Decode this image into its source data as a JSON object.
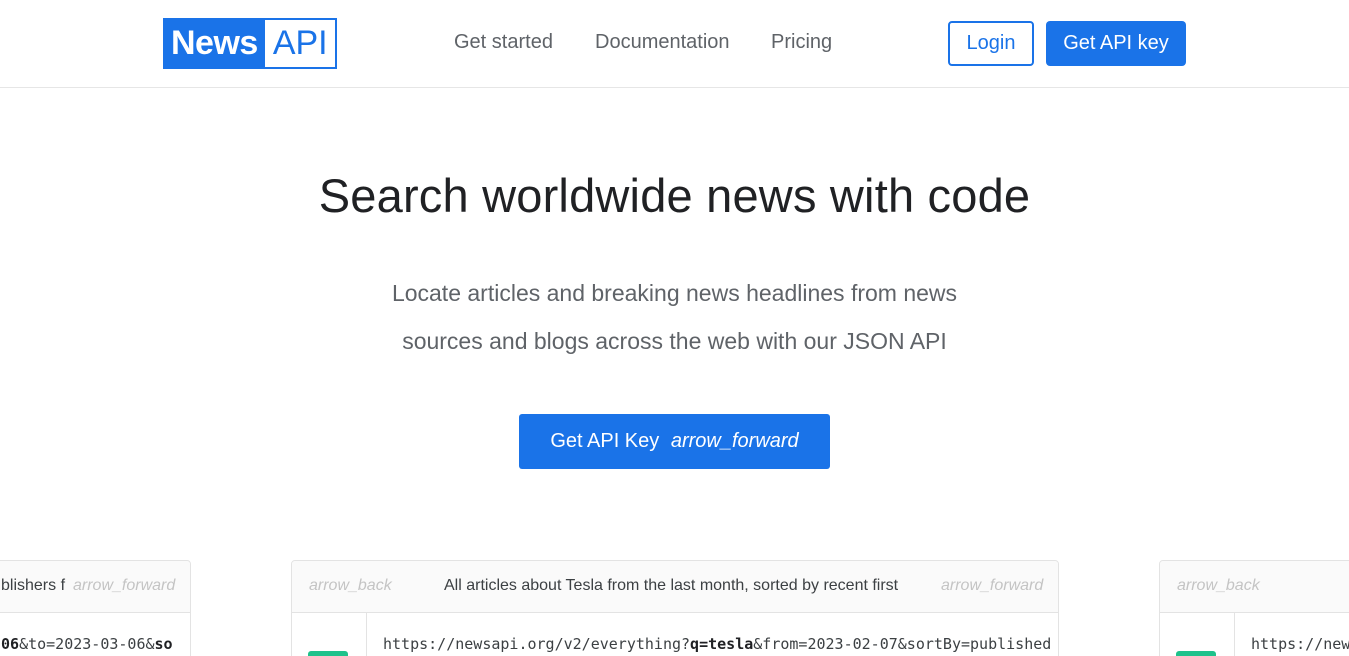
{
  "header": {
    "logo_news": "News",
    "logo_api": "API",
    "nav": [
      "Get started",
      "Documentation",
      "Pricing"
    ],
    "login_label": "Login",
    "get_key_label": "Get API key"
  },
  "hero": {
    "title": "Search worldwide news with code",
    "subtitle_line1": "Locate articles and breaking news headlines from news",
    "subtitle_line2": "sources and blogs across the web with our JSON API",
    "cta_label": "Get API Key",
    "cta_icon": "arrow_forward"
  },
  "carousel": {
    "left_card": {
      "caption_fragment": "blishers f",
      "next_icon": "arrow_forward",
      "code_bold_start": "06",
      "code_mid": "&to=2023-03-06&",
      "code_bold_end": "so"
    },
    "center_card": {
      "prev_icon": "arrow_back",
      "caption": "All articles about Tesla from the last month, sorted by recent first",
      "next_icon": "arrow_forward",
      "code_prefix": "https://newsapi.org/v2/everything?",
      "code_bold": "q=tesla",
      "code_suffix": "&from=2023-02-07&sortBy=published"
    },
    "right_card": {
      "prev_icon": "arrow_back",
      "code_prefix": "https://new"
    }
  },
  "colors": {
    "brand_blue": "#1a73e8",
    "badge_green": "#1ec28b",
    "muted_text": "#5f6368"
  }
}
